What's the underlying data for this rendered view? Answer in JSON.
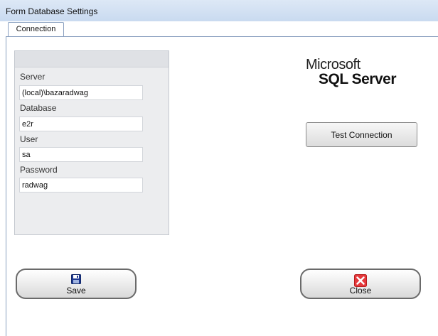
{
  "window": {
    "title": "Form Database Settings"
  },
  "tabs": [
    {
      "label": "Connection"
    }
  ],
  "form": {
    "server_label": "Server",
    "server_value": "(local)\\bazaradwag",
    "database_label": "Database",
    "database_value": "e2r",
    "user_label": "User",
    "user_value": "sa",
    "password_label": "Password",
    "password_value": "radwag"
  },
  "logo": {
    "line1": "Microsoft",
    "line2": "SQL Server"
  },
  "buttons": {
    "test_connection": "Test Connection",
    "save": "Save",
    "close": "Close",
    "save_icon": "floppy-disk-icon",
    "close_icon": "red-x-icon"
  },
  "colors": {
    "titlebar": "#c9daf0",
    "close_icon": "#e5393c",
    "save_icon": "#1f3a93"
  }
}
